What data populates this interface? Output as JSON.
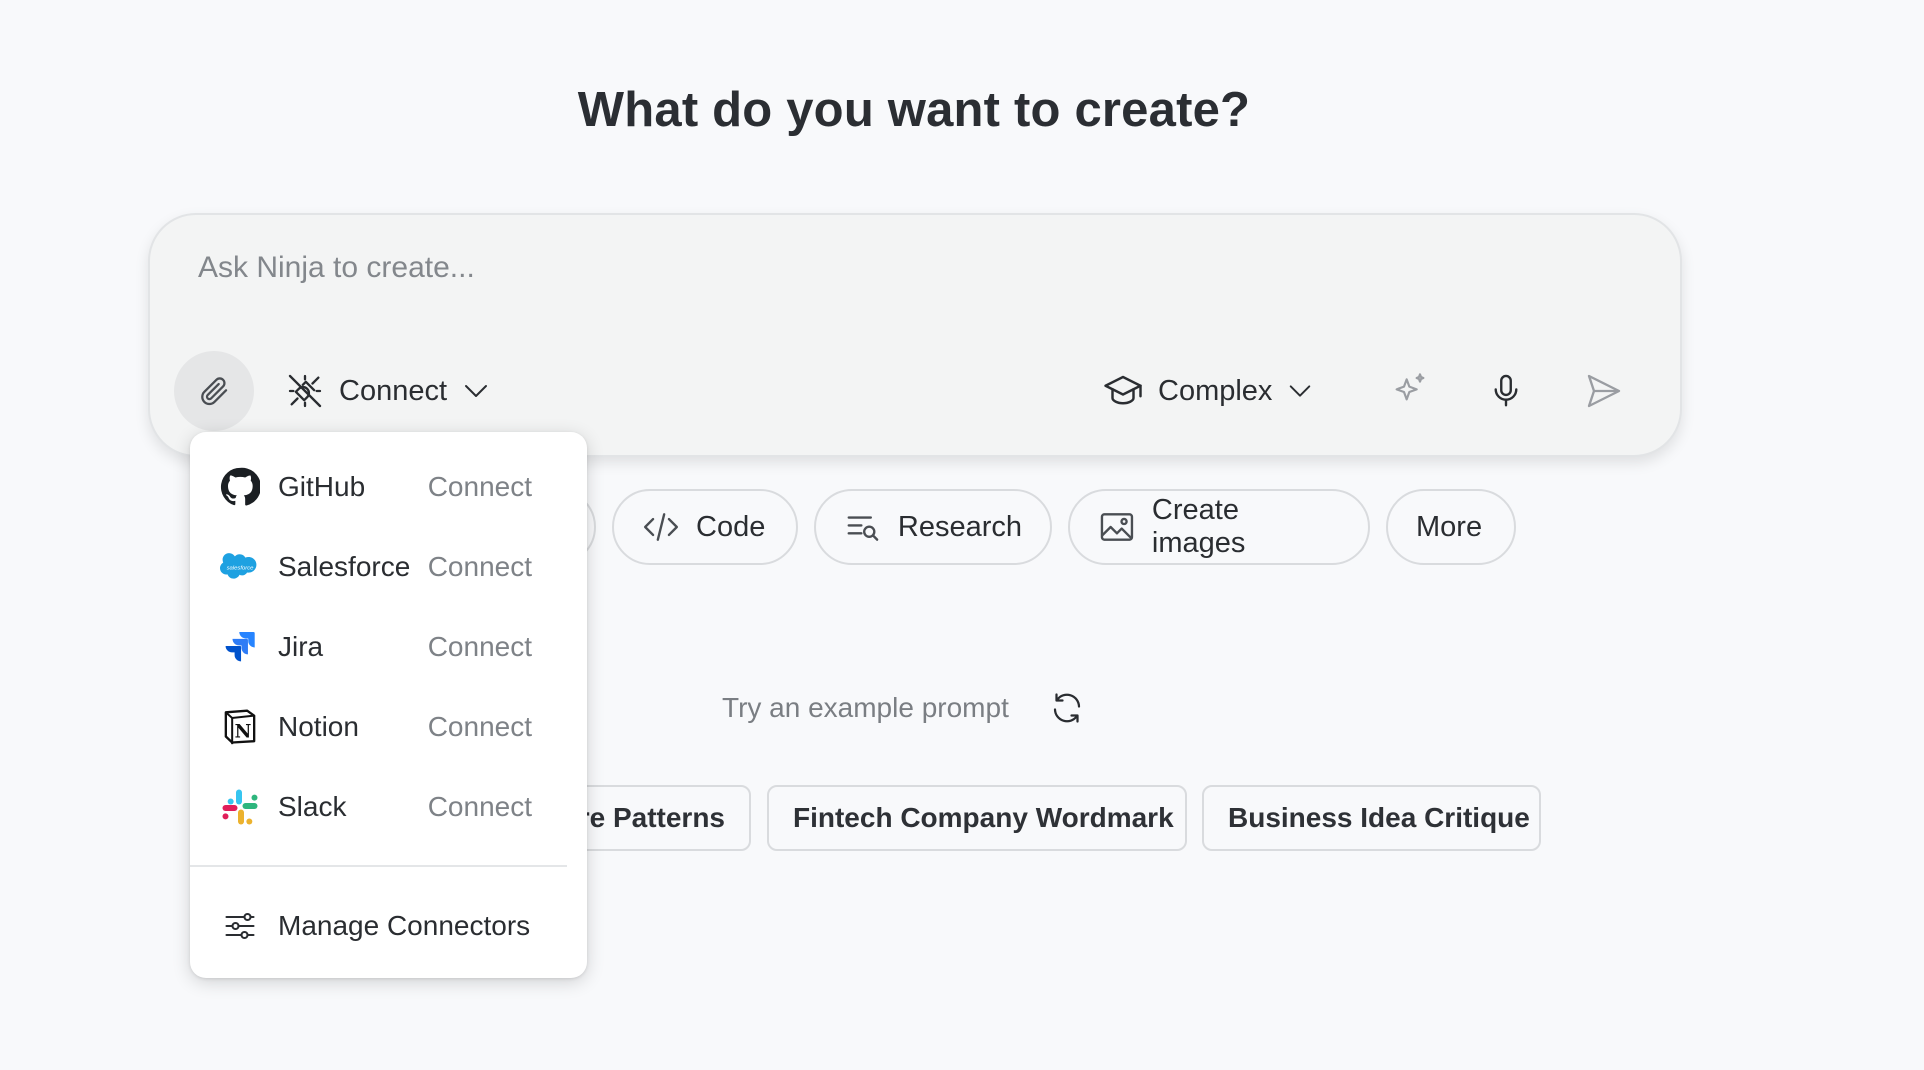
{
  "heading": "What do you want to create?",
  "composer": {
    "placeholder": "Ask Ninja to create...",
    "value": "",
    "connect_label": "Connect",
    "mode_label": "Complex"
  },
  "quick_actions": [
    {
      "label": "Code",
      "icon": "code-icon"
    },
    {
      "label": "Research",
      "icon": "research-icon"
    },
    {
      "label": "Create images",
      "icon": "image-icon"
    },
    {
      "label": "More"
    }
  ],
  "examples": {
    "label": "Try an example prompt",
    "prompts": [
      "re Patterns",
      "Fintech Company Wordmark",
      "Business Idea Critique"
    ]
  },
  "connectors_menu": {
    "items": [
      {
        "name": "GitHub",
        "action": "Connect",
        "icon": "github-logo"
      },
      {
        "name": "Salesforce",
        "action": "Connect",
        "icon": "salesforce-logo",
        "logo_text": "salesforce"
      },
      {
        "name": "Jira",
        "action": "Connect",
        "icon": "jira-logo"
      },
      {
        "name": "Notion",
        "action": "Connect",
        "icon": "notion-logo",
        "logo_text": "N"
      },
      {
        "name": "Slack",
        "action": "Connect",
        "icon": "slack-logo"
      }
    ],
    "manage_label": "Manage Connectors"
  },
  "colors": {
    "background": "#f8f9fb",
    "composer_bg": "#f3f4f4",
    "text": "#2a2d31",
    "muted": "#7e8287",
    "salesforce": "#1ea1e1",
    "jira": "#2684ff",
    "slack_red": "#e01e5a",
    "slack_green": "#2eb67d",
    "slack_blue": "#36c5f0",
    "slack_yellow": "#ecb22e"
  }
}
